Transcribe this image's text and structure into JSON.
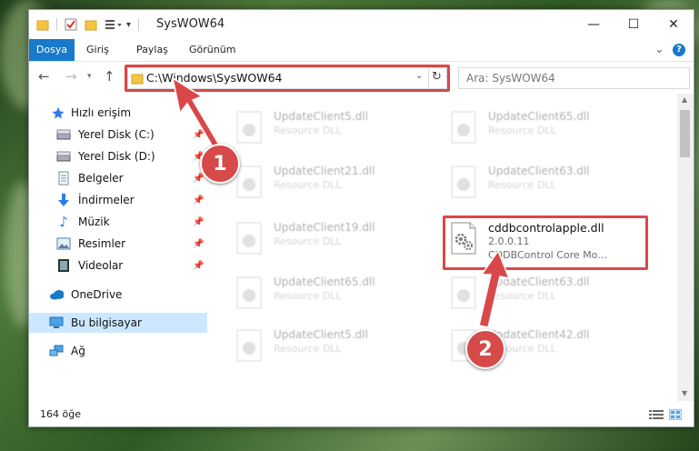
{
  "window": {
    "title": "SysWOW64",
    "controls": {
      "minimize": "—",
      "maximize": "☐",
      "close": "✕"
    }
  },
  "ribbon": {
    "tabs": [
      "Dosya",
      "Giriş",
      "Paylaş",
      "Görünüm"
    ],
    "expand": "⌄",
    "help": "?"
  },
  "address": {
    "path": "C:\\Windows\\SysWOW64",
    "search_placeholder": "Ara: SysWOW64"
  },
  "sidebar": {
    "quick_access": "Hızlı erişim",
    "items": [
      {
        "label": "Yerel Disk (C:)",
        "icon": "drive-icon",
        "pinned": true
      },
      {
        "label": "Yerel Disk (D:)",
        "icon": "drive-icon",
        "pinned": true
      },
      {
        "label": "Belgeler",
        "icon": "documents-icon",
        "pinned": true
      },
      {
        "label": "İndirmeler",
        "icon": "download-icon",
        "pinned": true
      },
      {
        "label": "Müzik",
        "icon": "music-icon",
        "pinned": true
      },
      {
        "label": "Resimler",
        "icon": "pictures-icon",
        "pinned": true
      },
      {
        "label": "Videolar",
        "icon": "videos-icon",
        "pinned": true
      }
    ],
    "onedrive": "OneDrive",
    "this_pc": "Bu bilgisayar",
    "network": "Ağ"
  },
  "files": [
    {
      "name": "UpdateClient5.dll",
      "desc": "Resource DLL"
    },
    {
      "name": "UpdateClient65.dll",
      "desc": "Resource DLL"
    },
    {
      "name": "UpdateClient21.dll",
      "desc": "Resource DLL"
    },
    {
      "name": "UpdateClient63.dll",
      "desc": "Resource DLL"
    },
    {
      "name": "UpdateClient19.dll",
      "desc": "Resource DLL"
    },
    {
      "name": "cddbcontrolapple.dll",
      "version": "2.0.0.11",
      "desc": "CDDBControl Core Mo..."
    },
    {
      "name": "UpdateClient65.dll",
      "desc": "Resource DLL"
    },
    {
      "name": "UpdateClient63.dll",
      "desc": "Resource DLL"
    },
    {
      "name": "UpdateClient5.dll",
      "desc": "Resource DLL"
    },
    {
      "name": "UpdateClient42.dll",
      "desc": "Resource DLL"
    }
  ],
  "status": {
    "count": "164 öğe"
  },
  "callouts": [
    "1",
    "2"
  ],
  "colors": {
    "accent": "#1979ca",
    "highlight": "#d94848",
    "selected": "#cce8ff"
  }
}
